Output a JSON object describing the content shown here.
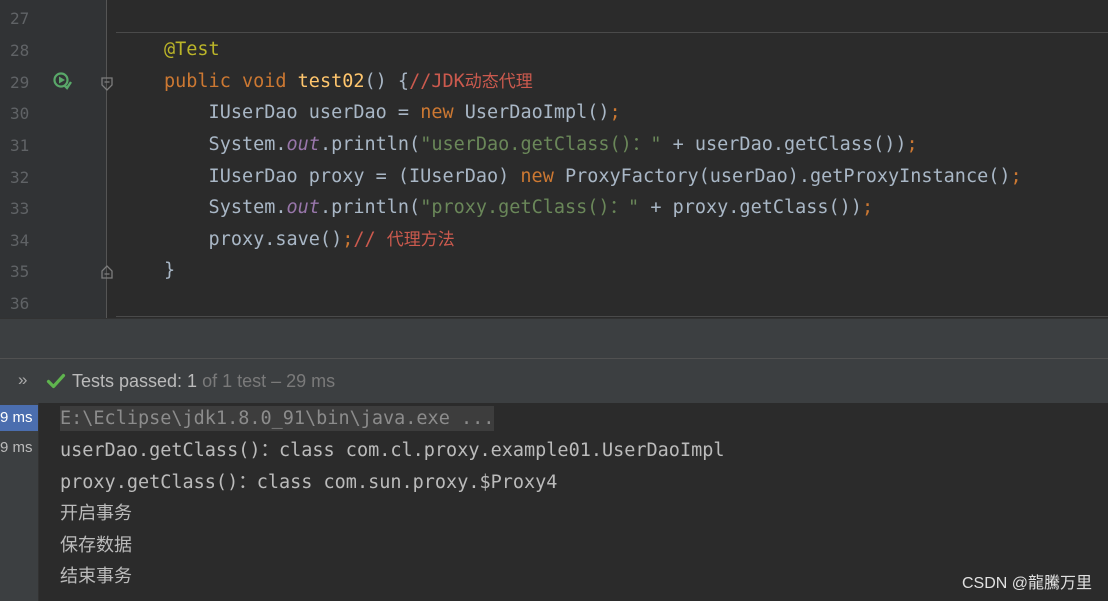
{
  "editor": {
    "line_numbers": [
      "27",
      "28",
      "29",
      "30",
      "31",
      "32",
      "33",
      "34",
      "35",
      "36"
    ],
    "lines": [
      {
        "parts": []
      },
      {
        "parts": [
          {
            "t": "@Test",
            "c": "ann"
          }
        ]
      },
      {
        "parts": [
          {
            "t": "public ",
            "c": "kw"
          },
          {
            "t": "void ",
            "c": "kw"
          },
          {
            "t": "test02",
            "c": "fn"
          },
          {
            "t": "() {",
            "c": ""
          },
          {
            "t": "//JDK",
            "c": "cmt"
          },
          {
            "t": "动态代理",
            "c": "cmt cjk"
          }
        ]
      },
      {
        "parts": [
          {
            "t": "    IUserDao userDao = ",
            "c": ""
          },
          {
            "t": "new ",
            "c": "kw"
          },
          {
            "t": "UserDaoImpl()",
            "c": ""
          },
          {
            "t": ";",
            "c": "kw"
          }
        ]
      },
      {
        "parts": [
          {
            "t": "    System.",
            "c": ""
          },
          {
            "t": "out",
            "c": "fld"
          },
          {
            "t": ".println(",
            "c": ""
          },
          {
            "t": "\"userDao.getClass()：\"",
            "c": "str"
          },
          {
            "t": " + userDao.getClass())",
            "c": ""
          },
          {
            "t": ";",
            "c": "kw"
          }
        ]
      },
      {
        "parts": [
          {
            "t": "    IUserDao proxy = (IUserDao) ",
            "c": ""
          },
          {
            "t": "new ",
            "c": "kw"
          },
          {
            "t": "ProxyFactory(userDao).getProxyInstance()",
            "c": ""
          },
          {
            "t": ";",
            "c": "kw"
          }
        ]
      },
      {
        "parts": [
          {
            "t": "    System.",
            "c": ""
          },
          {
            "t": "out",
            "c": "fld"
          },
          {
            "t": ".println(",
            "c": ""
          },
          {
            "t": "\"proxy.getClass()：\"",
            "c": "str"
          },
          {
            "t": " + proxy.getClass())",
            "c": ""
          },
          {
            "t": ";",
            "c": "kw"
          }
        ]
      },
      {
        "parts": [
          {
            "t": "    proxy.save()",
            "c": ""
          },
          {
            "t": ";",
            "c": "kw"
          },
          {
            "t": "// ",
            "c": "cmt"
          },
          {
            "t": "代理方法",
            "c": "cmt cjk"
          }
        ]
      },
      {
        "parts": [
          {
            "t": "}",
            "c": ""
          }
        ]
      },
      {
        "parts": []
      }
    ]
  },
  "test_header": {
    "expand_icon": "»",
    "passed_label": "Tests passed: 1",
    "passed_detail": " of 1 test – 29 ms"
  },
  "tree": {
    "times": [
      "9 ms",
      "9 ms"
    ]
  },
  "console": {
    "command": "E:\\Eclipse\\jdk1.8.0_91\\bin\\java.exe ...",
    "output": [
      "userDao.getClass()：class com.cl.proxy.example01.UserDaoImpl",
      "proxy.getClass()：class com.sun.proxy.$Proxy4",
      "开启事务",
      "保存数据",
      "结束事务"
    ]
  },
  "watermark": "CSDN @龍騰万里",
  "colors": {
    "editor_bg": "#2b2b2b",
    "gutter_bg": "#313335",
    "keyword": "#cc7832",
    "string": "#6a8759",
    "comment": "#cc5a4e",
    "annotation": "#bbb529",
    "pass_green": "#5fb44e",
    "selection_blue": "#4b6eaf"
  }
}
